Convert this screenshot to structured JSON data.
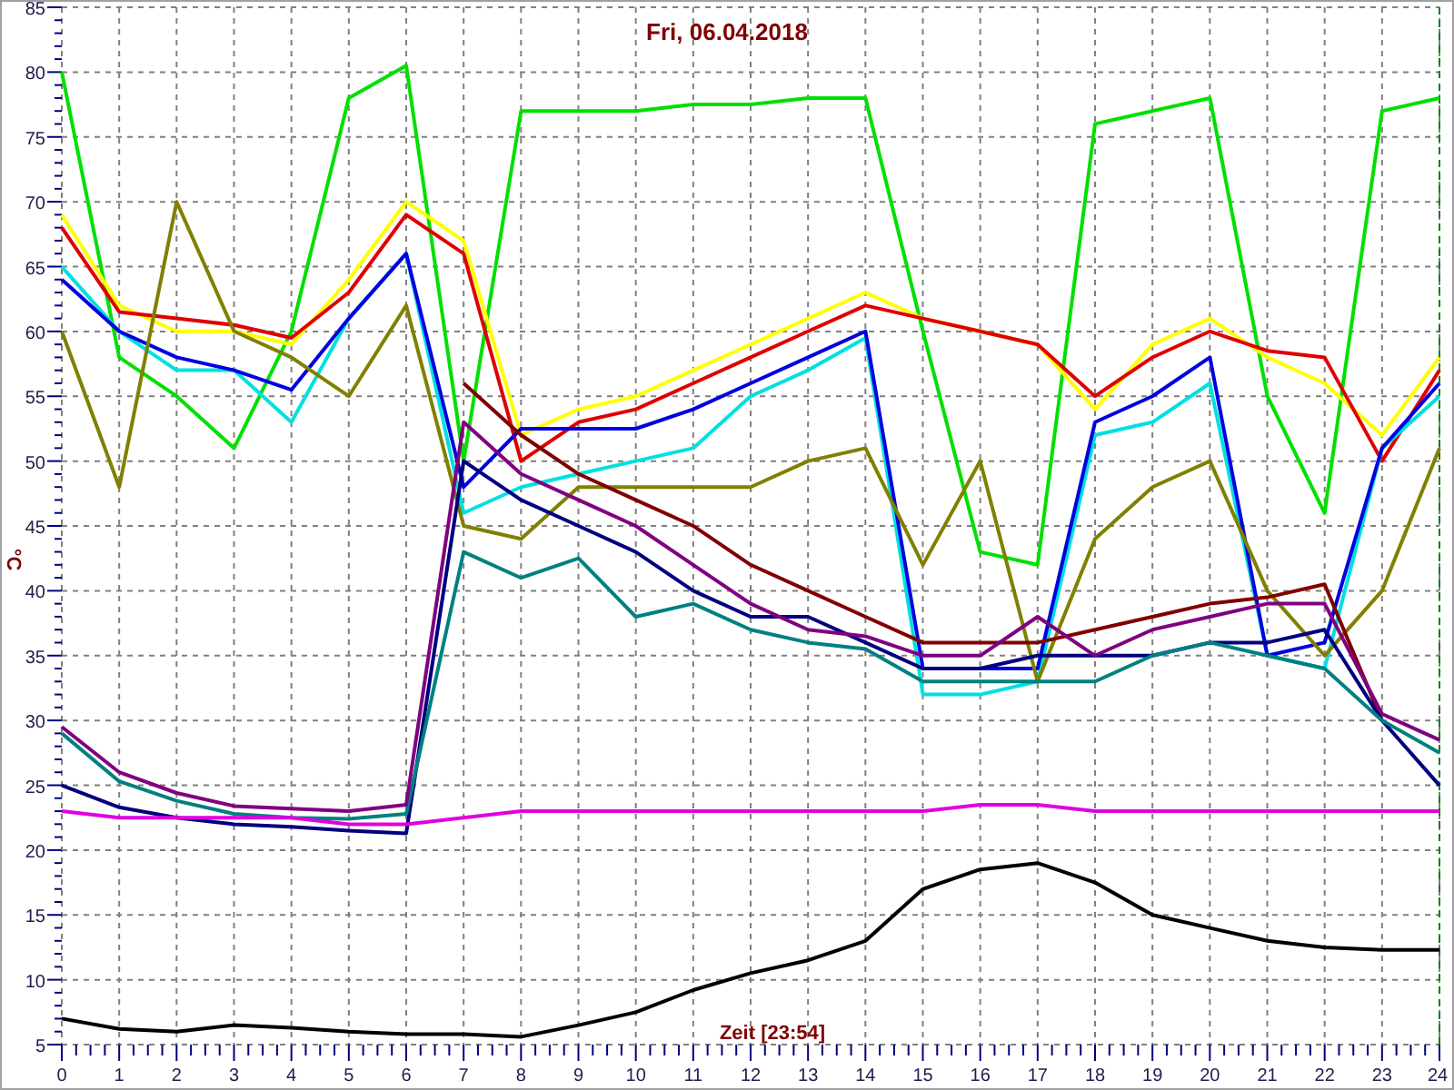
{
  "chart": {
    "chart_data": {
      "type": "line",
      "title": "Fri, 06.04.2018",
      "xlabel": "Zeit [23:54]",
      "ylabel": "°C",
      "x": [
        0,
        1,
        2,
        3,
        4,
        5,
        6,
        7,
        8,
        9,
        10,
        11,
        12,
        13,
        14,
        15,
        16,
        17,
        18,
        19,
        20,
        21,
        22,
        23,
        24
      ],
      "grid": true,
      "xlim": [
        0,
        24
      ],
      "ylim": [
        5,
        85
      ],
      "xticks": [
        0,
        1,
        2,
        3,
        4,
        5,
        6,
        7,
        8,
        9,
        10,
        11,
        12,
        13,
        14,
        15,
        16,
        17,
        18,
        19,
        20,
        21,
        22,
        23,
        24
      ],
      "yticks": [
        5,
        10,
        15,
        20,
        25,
        30,
        35,
        40,
        45,
        50,
        55,
        60,
        65,
        70,
        75,
        80,
        85
      ],
      "series": [
        {
          "color": "#00e000",
          "values": [
            80,
            58,
            55,
            51,
            60,
            78,
            80.5,
            50,
            77,
            77,
            77,
            77.5,
            77.5,
            78,
            78,
            60,
            43,
            42,
            76,
            77,
            78,
            55,
            46,
            77,
            78
          ]
        },
        {
          "color": "#ffff00",
          "values": [
            69,
            62,
            60,
            60,
            59,
            64,
            70,
            67,
            52,
            54,
            55,
            57,
            59,
            61,
            63,
            61,
            60,
            59,
            54,
            59,
            61,
            58,
            56,
            52,
            58
          ]
        },
        {
          "color": "#e00000",
          "values": [
            68,
            61.5,
            61,
            60.5,
            59.5,
            63,
            69,
            66,
            50,
            53,
            54,
            56,
            58,
            60,
            62,
            61,
            60,
            59,
            55,
            58,
            60,
            58.5,
            58,
            50,
            57
          ]
        },
        {
          "color": "#00e0e0",
          "values": [
            65,
            60,
            57,
            57,
            53,
            61,
            66,
            46,
            48,
            49,
            50,
            51,
            55,
            57,
            59.5,
            32,
            32,
            33,
            52,
            53,
            56,
            35,
            34,
            51,
            55
          ]
        },
        {
          "color": "#0000e0",
          "values": [
            64,
            60,
            58,
            57,
            55.5,
            61,
            66,
            48,
            52.5,
            52.5,
            52.5,
            54,
            56,
            58,
            60,
            34,
            34,
            34,
            53,
            55,
            58,
            35,
            36,
            51,
            56
          ]
        },
        {
          "color": "#808000",
          "values": [
            60,
            48,
            70,
            60,
            58,
            55,
            62,
            45,
            44,
            48,
            48,
            48,
            48,
            50,
            51,
            42,
            50,
            33,
            44,
            48,
            50,
            40,
            35,
            40,
            51
          ]
        },
        {
          "color": "#800000",
          "values": [
            null,
            null,
            null,
            null,
            null,
            null,
            null,
            56,
            52,
            49,
            47,
            45,
            42,
            40,
            38,
            36,
            36,
            36,
            37,
            38,
            39,
            39.5,
            40.5,
            30,
            null
          ]
        },
        {
          "color": "#000080",
          "values": [
            25,
            23.3,
            22.5,
            22,
            21.8,
            21.5,
            21.3,
            50,
            47,
            45,
            43,
            40,
            38,
            38,
            36,
            34,
            34,
            35,
            35,
            35,
            36,
            36,
            37,
            30,
            25
          ]
        },
        {
          "color": "#008080",
          "values": [
            29,
            25.3,
            23.8,
            22.8,
            22.5,
            22.4,
            22.8,
            43,
            41,
            42.5,
            38,
            39,
            37,
            36,
            35.5,
            33,
            33,
            33,
            33,
            35,
            36,
            35,
            34,
            30,
            27.5
          ]
        },
        {
          "color": "#800080",
          "values": [
            29.5,
            26,
            24.4,
            23.4,
            23.2,
            23,
            23.5,
            53,
            49,
            47,
            45,
            42,
            39,
            37,
            36.5,
            35,
            35,
            38,
            35,
            37,
            38,
            39,
            39,
            30.5,
            28.5
          ]
        },
        {
          "color": "#e000e0",
          "values": [
            23,
            22.5,
            22.5,
            22.5,
            22.5,
            22,
            22,
            22.5,
            23,
            23,
            23,
            23,
            23,
            23,
            23,
            23,
            23.5,
            23.5,
            23,
            23,
            23,
            23,
            23,
            23,
            23
          ]
        },
        {
          "color": "#000000",
          "values": [
            7,
            6.2,
            6,
            6.5,
            6.3,
            6,
            5.8,
            5.8,
            5.6,
            6.5,
            7.5,
            9.2,
            10.5,
            11.5,
            13,
            17,
            18.5,
            19,
            17.5,
            15,
            14,
            13,
            12.5,
            12.3,
            12.3
          ]
        }
      ]
    }
  }
}
